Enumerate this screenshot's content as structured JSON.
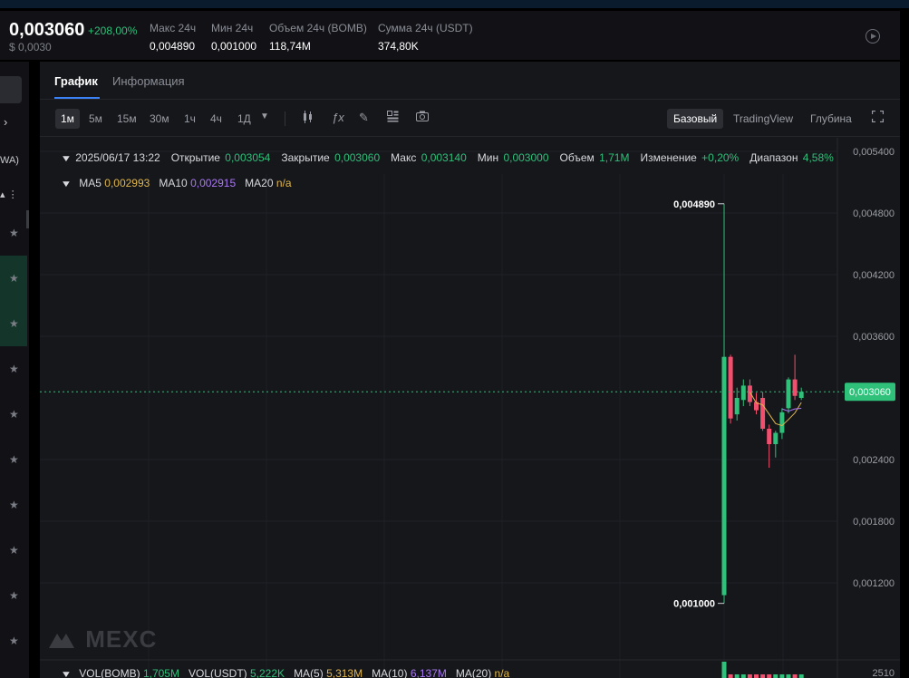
{
  "ticker": {
    "price": "0,003060",
    "change": "+208,00%",
    "price_usd": "$ 0,0030",
    "stats": [
      {
        "label": "Макс 24ч",
        "value": "0,004890"
      },
      {
        "label": "Мин 24ч",
        "value": "0,001000"
      },
      {
        "label": "Объем 24ч (BOMB)",
        "value": "118,74M"
      },
      {
        "label": "Сумма 24ч (USDT)",
        "value": "374,80K"
      }
    ]
  },
  "left": {
    "partial_text": "WA)",
    "sort_symbol": "▴ ⋮"
  },
  "tabs": [
    {
      "label": "График"
    },
    {
      "label": "Информация"
    }
  ],
  "toolbar": {
    "timeframes": [
      "1м",
      "5м",
      "15м",
      "30м",
      "1ч",
      "4ч",
      "1Д"
    ],
    "views": [
      "Базовый",
      "TradingView",
      "Глубина"
    ],
    "icons": [
      "candle-type-icon",
      "indicator-fx-icon",
      "draw-pencil-icon",
      "layout-grid-icon",
      "camera-icon",
      "fullscreen-icon",
      "chevron-down-icon"
    ]
  },
  "ohlc": {
    "datetime": "2025/06/17 13:22",
    "open_label": "Открытие",
    "open": "0,003054",
    "close_label": "Закрытие",
    "close": "0,003060",
    "high_label": "Макс",
    "high": "0,003140",
    "low_label": "Мин",
    "low": "0,003000",
    "volume_label": "Объем",
    "volume": "1,71M",
    "change_label": "Изменение",
    "change": "+0,20%",
    "range_label": "Диапазон",
    "range": "4,58%"
  },
  "ma": {
    "ma5_label": "MA5",
    "ma5": "0,002993",
    "ma10_label": "MA10",
    "ma10": "0,002915",
    "ma20_label": "MA20",
    "ma20": "n/a"
  },
  "volume_row": {
    "vol_bomb_label": "VOL(BOMB)",
    "vol_bomb": "1,705M",
    "vol_usdt_label": "VOL(USDT)",
    "vol_usdt": "5,222K",
    "ma5_label": "MA(5)",
    "ma5": "5,313M",
    "ma10_label": "MA(10)",
    "ma10": "6,137M",
    "ma20_label": "MA(20)",
    "ma20": "n/a"
  },
  "watermark": "MEXC",
  "colors": {
    "up": "#2fc07a",
    "down": "#f0506e",
    "accent": "#3b82f6",
    "ma5": "#e0b64c",
    "ma10": "#a978f5"
  },
  "chart_data": {
    "type": "candlestick",
    "y_ticks": [
      "0,005400",
      "0,004800",
      "0,004200",
      "0,003600",
      "0,002400",
      "0,001800",
      "0,001200"
    ],
    "current_price_label": "0,003060",
    "high_marker": "0,004890",
    "low_marker": "0,001000",
    "last_tick_partial": "2510",
    "candles": [
      {
        "o": 0.00108,
        "h": 0.00489,
        "l": 0.001,
        "c": 0.0034
      },
      {
        "o": 0.0034,
        "h": 0.00342,
        "l": 0.00275,
        "c": 0.0028
      },
      {
        "o": 0.00284,
        "h": 0.0031,
        "l": 0.00278,
        "c": 0.003
      },
      {
        "o": 0.00298,
        "h": 0.00318,
        "l": 0.00292,
        "c": 0.00312
      },
      {
        "o": 0.00312,
        "h": 0.00318,
        "l": 0.00292,
        "c": 0.00296
      },
      {
        "o": 0.00296,
        "h": 0.00305,
        "l": 0.00284,
        "c": 0.00288
      },
      {
        "o": 0.003,
        "h": 0.00306,
        "l": 0.00268,
        "c": 0.0027
      },
      {
        "o": 0.0027,
        "h": 0.00274,
        "l": 0.00232,
        "c": 0.00255
      },
      {
        "o": 0.00255,
        "h": 0.00268,
        "l": 0.00242,
        "c": 0.00266
      },
      {
        "o": 0.00266,
        "h": 0.0029,
        "l": 0.0026,
        "c": 0.00286
      },
      {
        "o": 0.0029,
        "h": 0.0032,
        "l": 0.00285,
        "c": 0.00318
      },
      {
        "o": 0.00318,
        "h": 0.00342,
        "l": 0.00298,
        "c": 0.00302
      },
      {
        "o": 0.003,
        "h": 0.0031,
        "l": 0.00298,
        "c": 0.00306
      }
    ]
  }
}
